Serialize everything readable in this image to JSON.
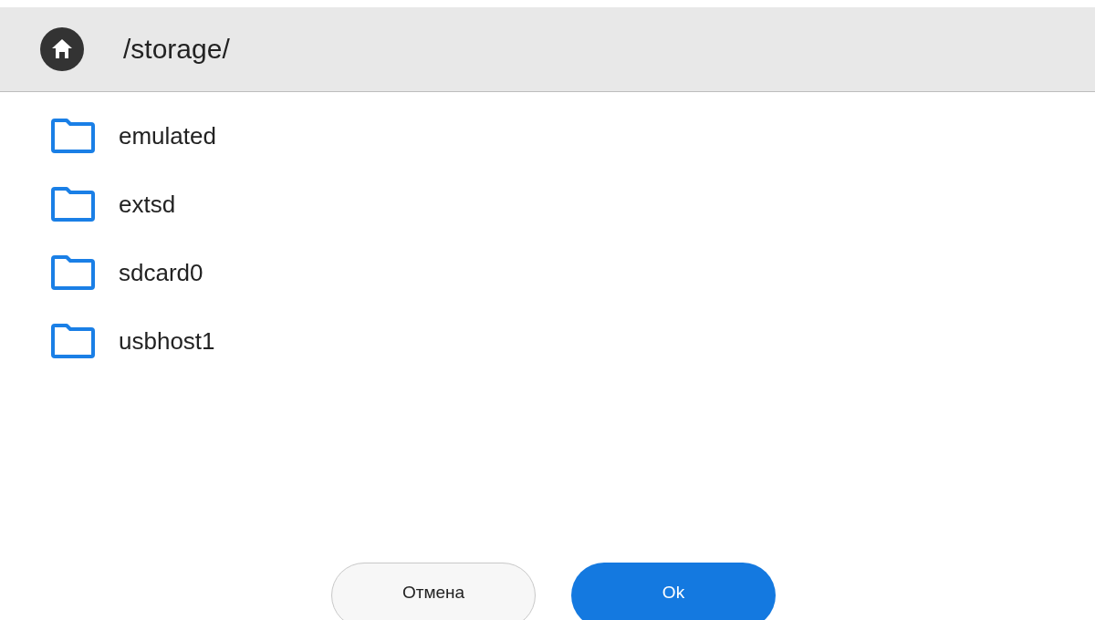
{
  "header": {
    "path": "/storage/"
  },
  "folders": [
    {
      "name": "emulated"
    },
    {
      "name": "extsd"
    },
    {
      "name": "sdcard0"
    },
    {
      "name": "usbhost1"
    }
  ],
  "buttons": [
    {
      "label": "Отмена",
      "kind": "secondary"
    },
    {
      "label": "Ok",
      "kind": "primary"
    }
  ]
}
